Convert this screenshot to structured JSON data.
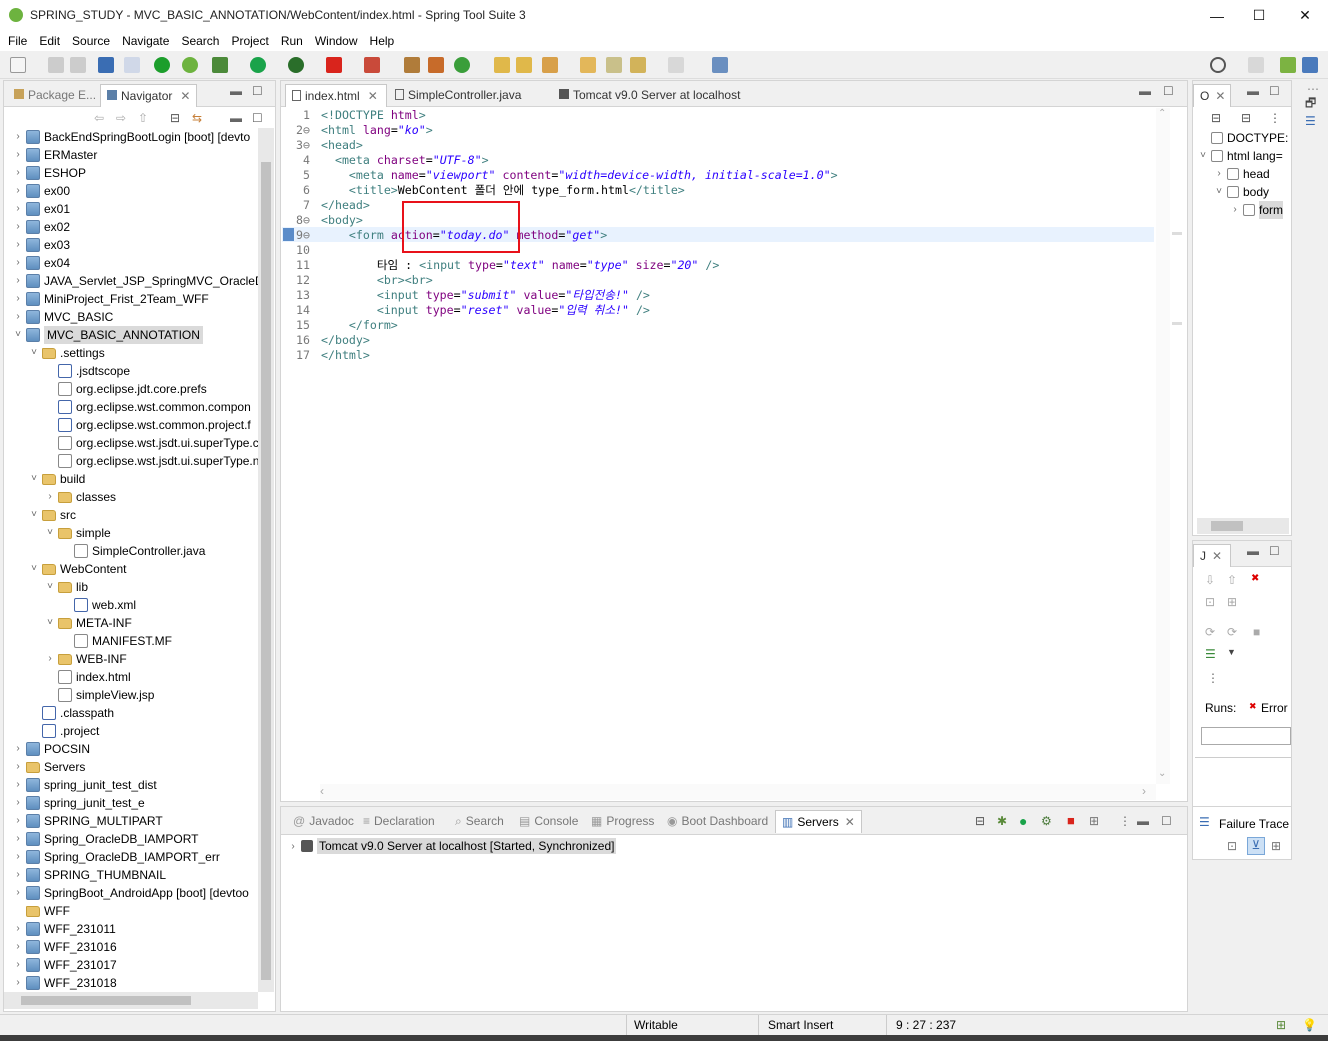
{
  "window": {
    "title": "SPRING_STUDY - MVC_BASIC_ANNOTATION/WebContent/index.html - Spring Tool Suite 3",
    "min": "—",
    "max": "☐",
    "close": "✕"
  },
  "menu": [
    "File",
    "Edit",
    "Source",
    "Navigate",
    "Search",
    "Project",
    "Run",
    "Window",
    "Help"
  ],
  "left_tabs": {
    "package": "Package E...",
    "navigator": "Navigator"
  },
  "tree": [
    {
      "label": "BackEndSpringBootLogin [boot] [devto",
      "lvl": 0,
      "arrow": "›",
      "type": "proj"
    },
    {
      "label": "ERMaster",
      "lvl": 0,
      "arrow": "›",
      "type": "proj"
    },
    {
      "label": "ESHOP",
      "lvl": 0,
      "arrow": "›",
      "type": "proj"
    },
    {
      "label": "ex00",
      "lvl": 0,
      "arrow": "›",
      "type": "proj"
    },
    {
      "label": "ex01",
      "lvl": 0,
      "arrow": "›",
      "type": "proj"
    },
    {
      "label": "ex02",
      "lvl": 0,
      "arrow": "›",
      "type": "proj"
    },
    {
      "label": "ex03",
      "lvl": 0,
      "arrow": "›",
      "type": "proj"
    },
    {
      "label": "ex04",
      "lvl": 0,
      "arrow": "›",
      "type": "proj"
    },
    {
      "label": "JAVA_Servlet_JSP_SpringMVC_OracleDB",
      "lvl": 0,
      "arrow": "›",
      "type": "proj"
    },
    {
      "label": "MiniProject_Frist_2Team_WFF",
      "lvl": 0,
      "arrow": "›",
      "type": "proj"
    },
    {
      "label": "MVC_BASIC",
      "lvl": 0,
      "arrow": "›",
      "type": "proj"
    },
    {
      "label": "MVC_BASIC_ANNOTATION",
      "lvl": 0,
      "arrow": "˅",
      "type": "proj",
      "sel": true
    },
    {
      "label": ".settings",
      "lvl": 1,
      "arrow": "˅",
      "type": "folder"
    },
    {
      "label": ".jsdtscope",
      "lvl": 2,
      "arrow": "",
      "type": "xfile"
    },
    {
      "label": "org.eclipse.jdt.core.prefs",
      "lvl": 2,
      "arrow": "",
      "type": "file"
    },
    {
      "label": "org.eclipse.wst.common.compon",
      "lvl": 2,
      "arrow": "",
      "type": "xfile"
    },
    {
      "label": "org.eclipse.wst.common.project.f",
      "lvl": 2,
      "arrow": "",
      "type": "xfile"
    },
    {
      "label": "org.eclipse.wst.jsdt.ui.superType.c",
      "lvl": 2,
      "arrow": "",
      "type": "file"
    },
    {
      "label": "org.eclipse.wst.jsdt.ui.superType.n",
      "lvl": 2,
      "arrow": "",
      "type": "file"
    },
    {
      "label": "build",
      "lvl": 1,
      "arrow": "˅",
      "type": "folder"
    },
    {
      "label": "classes",
      "lvl": 2,
      "arrow": "›",
      "type": "folder"
    },
    {
      "label": "src",
      "lvl": 1,
      "arrow": "˅",
      "type": "folder"
    },
    {
      "label": "simple",
      "lvl": 2,
      "arrow": "˅",
      "type": "folder"
    },
    {
      "label": "SimpleController.java",
      "lvl": 3,
      "arrow": "",
      "type": "file"
    },
    {
      "label": "WebContent",
      "lvl": 1,
      "arrow": "˅",
      "type": "folder"
    },
    {
      "label": "lib",
      "lvl": 2,
      "arrow": "˅",
      "type": "folder"
    },
    {
      "label": "web.xml",
      "lvl": 3,
      "arrow": "",
      "type": "xfile"
    },
    {
      "label": "META-INF",
      "lvl": 2,
      "arrow": "˅",
      "type": "folder"
    },
    {
      "label": "MANIFEST.MF",
      "lvl": 3,
      "arrow": "",
      "type": "file"
    },
    {
      "label": "WEB-INF",
      "lvl": 2,
      "arrow": "›",
      "type": "folder"
    },
    {
      "label": "index.html",
      "lvl": 2,
      "arrow": "",
      "type": "file"
    },
    {
      "label": "simpleView.jsp",
      "lvl": 2,
      "arrow": "",
      "type": "file"
    },
    {
      "label": ".classpath",
      "lvl": 1,
      "arrow": "",
      "type": "xfile"
    },
    {
      "label": ".project",
      "lvl": 1,
      "arrow": "",
      "type": "xfile"
    },
    {
      "label": "POCSIN",
      "lvl": 0,
      "arrow": "›",
      "type": "proj"
    },
    {
      "label": "Servers",
      "lvl": 0,
      "arrow": "›",
      "type": "folder"
    },
    {
      "label": "spring_junit_test_dist",
      "lvl": 0,
      "arrow": "›",
      "type": "proj"
    },
    {
      "label": "spring_junit_test_e",
      "lvl": 0,
      "arrow": "›",
      "type": "proj"
    },
    {
      "label": "SPRING_MULTIPART",
      "lvl": 0,
      "arrow": "›",
      "type": "proj"
    },
    {
      "label": "Spring_OracleDB_IAMPORT",
      "lvl": 0,
      "arrow": "›",
      "type": "proj"
    },
    {
      "label": "Spring_OracleDB_IAMPORT_err",
      "lvl": 0,
      "arrow": "›",
      "type": "proj"
    },
    {
      "label": "SPRING_THUMBNAIL",
      "lvl": 0,
      "arrow": "›",
      "type": "proj"
    },
    {
      "label": "SpringBoot_AndroidApp [boot] [devtoo",
      "lvl": 0,
      "arrow": "›",
      "type": "proj"
    },
    {
      "label": "WFF",
      "lvl": 0,
      "arrow": "",
      "type": "folder"
    },
    {
      "label": "WFF_231011",
      "lvl": 0,
      "arrow": "›",
      "type": "proj"
    },
    {
      "label": "WFF_231016",
      "lvl": 0,
      "arrow": "›",
      "type": "proj"
    },
    {
      "label": "WFF_231017",
      "lvl": 0,
      "arrow": "›",
      "type": "proj"
    },
    {
      "label": "WFF_231018",
      "lvl": 0,
      "arrow": "›",
      "type": "proj"
    }
  ],
  "editor_tabs": [
    "index.html",
    "SimpleController.java",
    "Tomcat v9.0 Server at localhost"
  ],
  "code": [
    {
      "n": "1",
      "parts": [
        [
          "tagc",
          "<!DOCTYPE "
        ],
        [
          "attr",
          "html"
        ],
        [
          "tagc",
          ">"
        ]
      ]
    },
    {
      "n": "2⊖",
      "parts": [
        [
          "tagc",
          "<html "
        ],
        [
          "attr",
          "lang"
        ],
        [
          "txt",
          "="
        ],
        [
          "val",
          "\"ko\""
        ],
        [
          "tagc",
          ">"
        ]
      ]
    },
    {
      "n": "3⊖",
      "parts": [
        [
          "tagc",
          "<head>"
        ]
      ]
    },
    {
      "n": "4",
      "parts": [
        [
          "txt",
          "  "
        ],
        [
          "tagc",
          "<meta "
        ],
        [
          "attr",
          "charset"
        ],
        [
          "txt",
          "="
        ],
        [
          "val",
          "\"UTF-8\""
        ],
        [
          "tagc",
          ">"
        ]
      ]
    },
    {
      "n": "5",
      "parts": [
        [
          "txt",
          "    "
        ],
        [
          "tagc",
          "<meta "
        ],
        [
          "attr",
          "name"
        ],
        [
          "txt",
          "="
        ],
        [
          "val",
          "\"viewport\""
        ],
        [
          "txt",
          " "
        ],
        [
          "attr",
          "content"
        ],
        [
          "txt",
          "="
        ],
        [
          "val",
          "\"width=device-width, initial-scale=1.0\""
        ],
        [
          "tagc",
          ">"
        ]
      ]
    },
    {
      "n": "6",
      "parts": [
        [
          "txt",
          "    "
        ],
        [
          "tagc",
          "<title>"
        ],
        [
          "txt",
          "WebContent 폴더 안에 type_form.html"
        ],
        [
          "tagc",
          "</title>"
        ]
      ]
    },
    {
      "n": "7",
      "parts": [
        [
          "tagc",
          "</head>"
        ]
      ]
    },
    {
      "n": "8⊖",
      "parts": [
        [
          "tagc",
          "<body>"
        ]
      ]
    },
    {
      "n": "9⊖",
      "parts": [
        [
          "txt",
          "    "
        ],
        [
          "tagc",
          "<form "
        ],
        [
          "attr",
          "action"
        ],
        [
          "txt",
          "="
        ],
        [
          "val",
          "\"today.do\""
        ],
        [
          "txt",
          " "
        ],
        [
          "attr",
          "method"
        ],
        [
          "txt",
          "="
        ],
        [
          "val",
          "\"get\""
        ],
        [
          "tagc",
          ">"
        ]
      ]
    },
    {
      "n": "10",
      "parts": []
    },
    {
      "n": "11",
      "parts": [
        [
          "txt",
          "        타임 : "
        ],
        [
          "tagc",
          "<input "
        ],
        [
          "attr",
          "type"
        ],
        [
          "txt",
          "="
        ],
        [
          "val",
          "\"text\""
        ],
        [
          "txt",
          " "
        ],
        [
          "attr",
          "name"
        ],
        [
          "txt",
          "="
        ],
        [
          "val",
          "\"type\""
        ],
        [
          "txt",
          " "
        ],
        [
          "attr",
          "size"
        ],
        [
          "txt",
          "="
        ],
        [
          "val",
          "\"20\""
        ],
        [
          "txt",
          " "
        ],
        [
          "tagc",
          "/>"
        ]
      ]
    },
    {
      "n": "12",
      "parts": [
        [
          "txt",
          "        "
        ],
        [
          "tagc",
          "<br><br>"
        ]
      ]
    },
    {
      "n": "13",
      "parts": [
        [
          "txt",
          "        "
        ],
        [
          "tagc",
          "<input "
        ],
        [
          "attr",
          "type"
        ],
        [
          "txt",
          "="
        ],
        [
          "val",
          "\"submit\""
        ],
        [
          "txt",
          " "
        ],
        [
          "attr",
          "value"
        ],
        [
          "txt",
          "="
        ],
        [
          "val",
          "\"타입전송!\""
        ],
        [
          "txt",
          " "
        ],
        [
          "tagc",
          "/>"
        ]
      ]
    },
    {
      "n": "14",
      "parts": [
        [
          "txt",
          "        "
        ],
        [
          "tagc",
          "<input "
        ],
        [
          "attr",
          "type"
        ],
        [
          "txt",
          "="
        ],
        [
          "val",
          "\"reset\""
        ],
        [
          "txt",
          " "
        ],
        [
          "attr",
          "value"
        ],
        [
          "txt",
          "="
        ],
        [
          "val",
          "\"입력 취소!\""
        ],
        [
          "txt",
          " "
        ],
        [
          "tagc",
          "/>"
        ]
      ]
    },
    {
      "n": "15",
      "parts": [
        [
          "txt",
          "    "
        ],
        [
          "tagc",
          "</form>"
        ]
      ]
    },
    {
      "n": "16",
      "parts": [
        [
          "tagc",
          "</body>"
        ]
      ]
    },
    {
      "n": "17",
      "parts": [
        [
          "tagc",
          "</html>"
        ]
      ]
    }
  ],
  "outline": {
    "tab": "O",
    "items": [
      {
        "label": "DOCTYPE:",
        "lvl": 0
      },
      {
        "label": "html lang=",
        "lvl": 0
      },
      {
        "label": "head",
        "lvl": 1
      },
      {
        "label": "body",
        "lvl": 1
      },
      {
        "label": "form",
        "lvl": 2
      }
    ]
  },
  "junit": {
    "tab": "J",
    "runs_label": "Runs:",
    "error_label": "Error",
    "failure_trace": "Failure Trace"
  },
  "bottom_tabs": [
    "Javadoc",
    "Declaration",
    "Search",
    "Console",
    "Progress",
    "Boot Dashboard",
    "Servers"
  ],
  "servers_row": "Tomcat v9.0 Server at localhost  [Started, Synchronized]",
  "status": {
    "writable": "Writable",
    "insert": "Smart Insert",
    "position": "9 : 27 : 237"
  },
  "colors": {
    "highlight_box": "#e8111a",
    "selected_row": "#dadada",
    "current_line": "#e8f2fe"
  }
}
